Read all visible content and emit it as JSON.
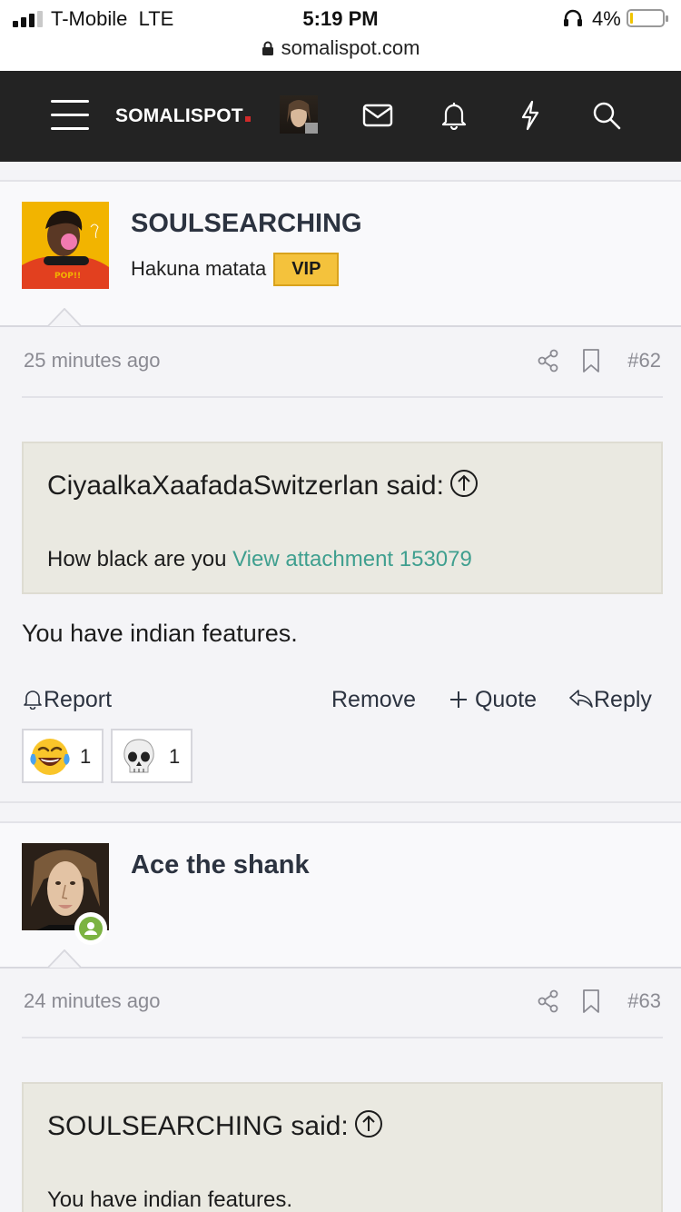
{
  "status_bar": {
    "carrier": "T-Mobile",
    "network": "LTE",
    "time": "5:19 PM",
    "battery": "4%",
    "battery_level": 0.04,
    "url": "somalispot.com"
  },
  "nav": {
    "logo": "SOMALISPOT",
    "icons": [
      "menu-icon",
      "avatar",
      "mail-icon",
      "bell-icon",
      "lightning-icon",
      "search-icon"
    ]
  },
  "posts": [
    {
      "author": "SOULSEARCHING",
      "user_title": "Hakuna matata",
      "badge": "VIP",
      "time": "25 minutes ago",
      "number": "#62",
      "quote_author": "CiyaalkaXaafadaSwitzerlan said:",
      "quote_text": "How black are you",
      "quote_link": "View attachment 153079",
      "message": "You have indian features.",
      "actions": {
        "report": "Report",
        "remove": "Remove",
        "quote": "Quote",
        "reply": "Reply"
      },
      "reactions": [
        {
          "emoji": "laughing-tears",
          "count": "1"
        },
        {
          "emoji": "skull",
          "count": "1"
        }
      ]
    },
    {
      "author": "Ace the shank",
      "time": "24 minutes ago",
      "number": "#63",
      "quote_author": "SOULSEARCHING said:",
      "quote_text": "You have indian features."
    }
  ],
  "colors": {
    "nav_bg": "#232323",
    "vip": "#f4c23c",
    "link": "#3f9f8f",
    "quote_bg": "#eae9e1",
    "online": "#7cb342"
  }
}
